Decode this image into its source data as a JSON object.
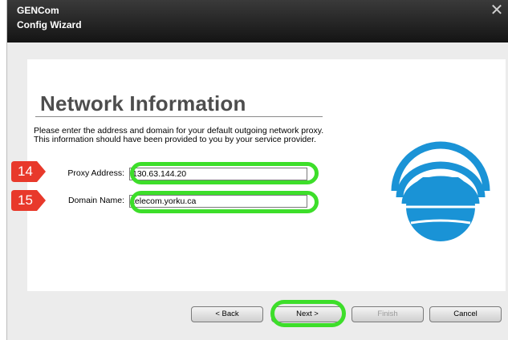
{
  "window": {
    "app_title": "GENCom",
    "subtitle": "Config Wizard",
    "close_glyph": "✕"
  },
  "page": {
    "heading": "Network Information",
    "description": "Please enter the address and domain for your default outgoing network proxy. This information should have been provided to you by your service provider."
  },
  "fields": {
    "proxy_label": "Proxy Address:",
    "proxy_value": "130.63.144.20",
    "domain_label": "Domain Name:",
    "domain_value": "telecom.yorku.ca"
  },
  "annotations": {
    "step_proxy": "14",
    "step_domain": "15",
    "badge_color": "#e8392b",
    "highlight_color": "#3dde2a"
  },
  "buttons": {
    "back": "< Back",
    "next": "Next >",
    "finish": "Finish",
    "cancel": "Cancel"
  },
  "colors": {
    "logo_blue": "#1a93d6",
    "titlebar": "#1f1f1f"
  }
}
